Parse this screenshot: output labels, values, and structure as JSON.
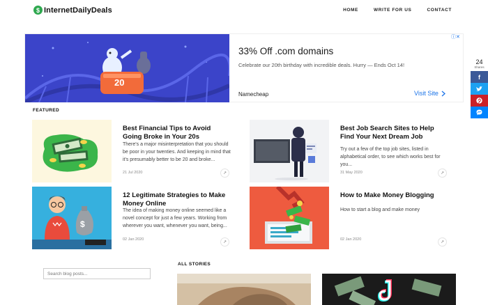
{
  "header": {
    "logo_symbol": "$",
    "logo_text": "InternetDailyDeals",
    "nav": [
      "HOME",
      "WRITE FOR US",
      "CONTACT"
    ]
  },
  "ad": {
    "badge_number": "20",
    "title": "33% Off .com domains",
    "description": "Celebrate our 20th birthday with incredible deals. Hurry — Ends Oct 14!",
    "advertiser": "Namecheap",
    "cta": "Visit Site",
    "cta_icon": "chevron-right-icon",
    "info_icon": "ad-info-icon"
  },
  "share": {
    "count": "24",
    "label": "Shares",
    "buttons": [
      {
        "icon": "facebook-icon",
        "glyph": "f",
        "color": "#3b5998"
      },
      {
        "icon": "twitter-icon",
        "glyph": "t",
        "color": "#1da1f2"
      },
      {
        "icon": "pinterest-icon",
        "glyph": "p",
        "color": "#cb2027"
      },
      {
        "icon": "messenger-icon",
        "glyph": "m",
        "color": "#0084ff"
      }
    ]
  },
  "featured": {
    "label": "FEATURED",
    "posts": [
      {
        "title": "Best Financial Tips to Avoid Going Broke in Your 20s",
        "excerpt": "There's a major misinterpretation that you should be poor in your twenties. And keeping in mind that it's presumably better to be 20 and broke...",
        "date": "21 Jul 2020"
      },
      {
        "title": "Best Job Search Sites to Help Find Your Next Dream Job",
        "excerpt": "Try out a few of the top job sites, listed in alphabetical order, to see which works best for you...",
        "date": "31 May 2020"
      },
      {
        "title": "12 Legitimate Strategies to Make Money Online",
        "excerpt": "The idea of making money online seemed like a novel concept for just a few years. Working from wherever you want, whenever you want, being...",
        "date": "02 Jan 2020"
      },
      {
        "title": "How to Make Money Blogging",
        "excerpt": "How to start a blog and make money",
        "date": "02 Jan 2020"
      }
    ]
  },
  "all_stories": {
    "label": "ALL STORIES"
  },
  "search": {
    "placeholder": "Search blog posts..."
  },
  "colors": {
    "accent_link": "#1a73e8",
    "ad_background": "#3b44c9",
    "ad_badge": "#f26b3a"
  }
}
